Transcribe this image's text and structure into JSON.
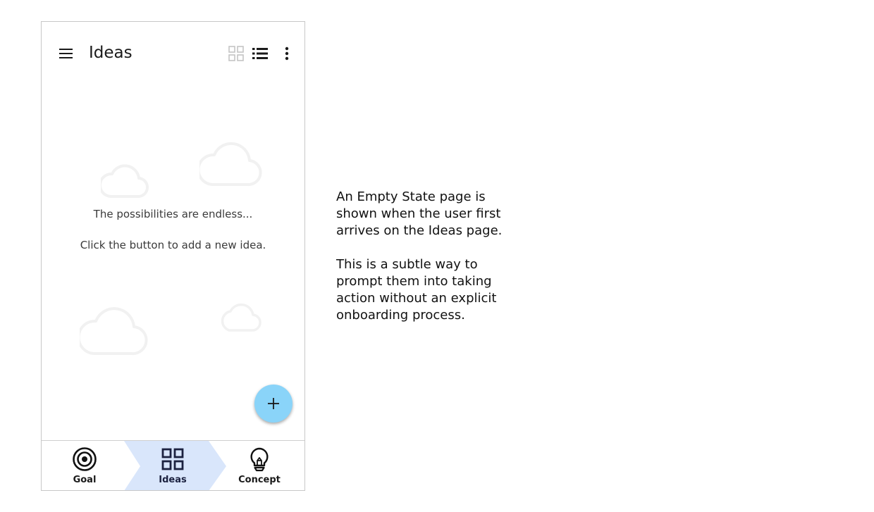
{
  "app_bar": {
    "title": "Ideas",
    "icons": [
      "menu-icon",
      "grid-view-icon",
      "list-view-icon",
      "more-vert-icon"
    ]
  },
  "empty_state": {
    "line1": "The possibilities are endless...",
    "line2": "Click the button to add a new idea.",
    "decoration": "cloud-icon"
  },
  "fab": {
    "icon": "plus-icon"
  },
  "bottom_nav": {
    "items": [
      {
        "label": "Goal",
        "icon": "target-icon",
        "active": false
      },
      {
        "label": "Ideas",
        "icon": "grid-icon",
        "active": true
      },
      {
        "label": "Concept",
        "icon": "lightbulb-icon",
        "active": false
      }
    ]
  },
  "annotation": {
    "paragraph1": "An Empty State page is shown when the user first arrives on the Ideas page.",
    "paragraph2": "This is a subtle way to prompt them into taking action without an explicit onboarding process."
  },
  "colors": {
    "fab": "#8ad4f9",
    "nav_active": "#d9e6fb",
    "cloud_stroke": "#f1f1f1",
    "border": "#c8c8c8"
  }
}
